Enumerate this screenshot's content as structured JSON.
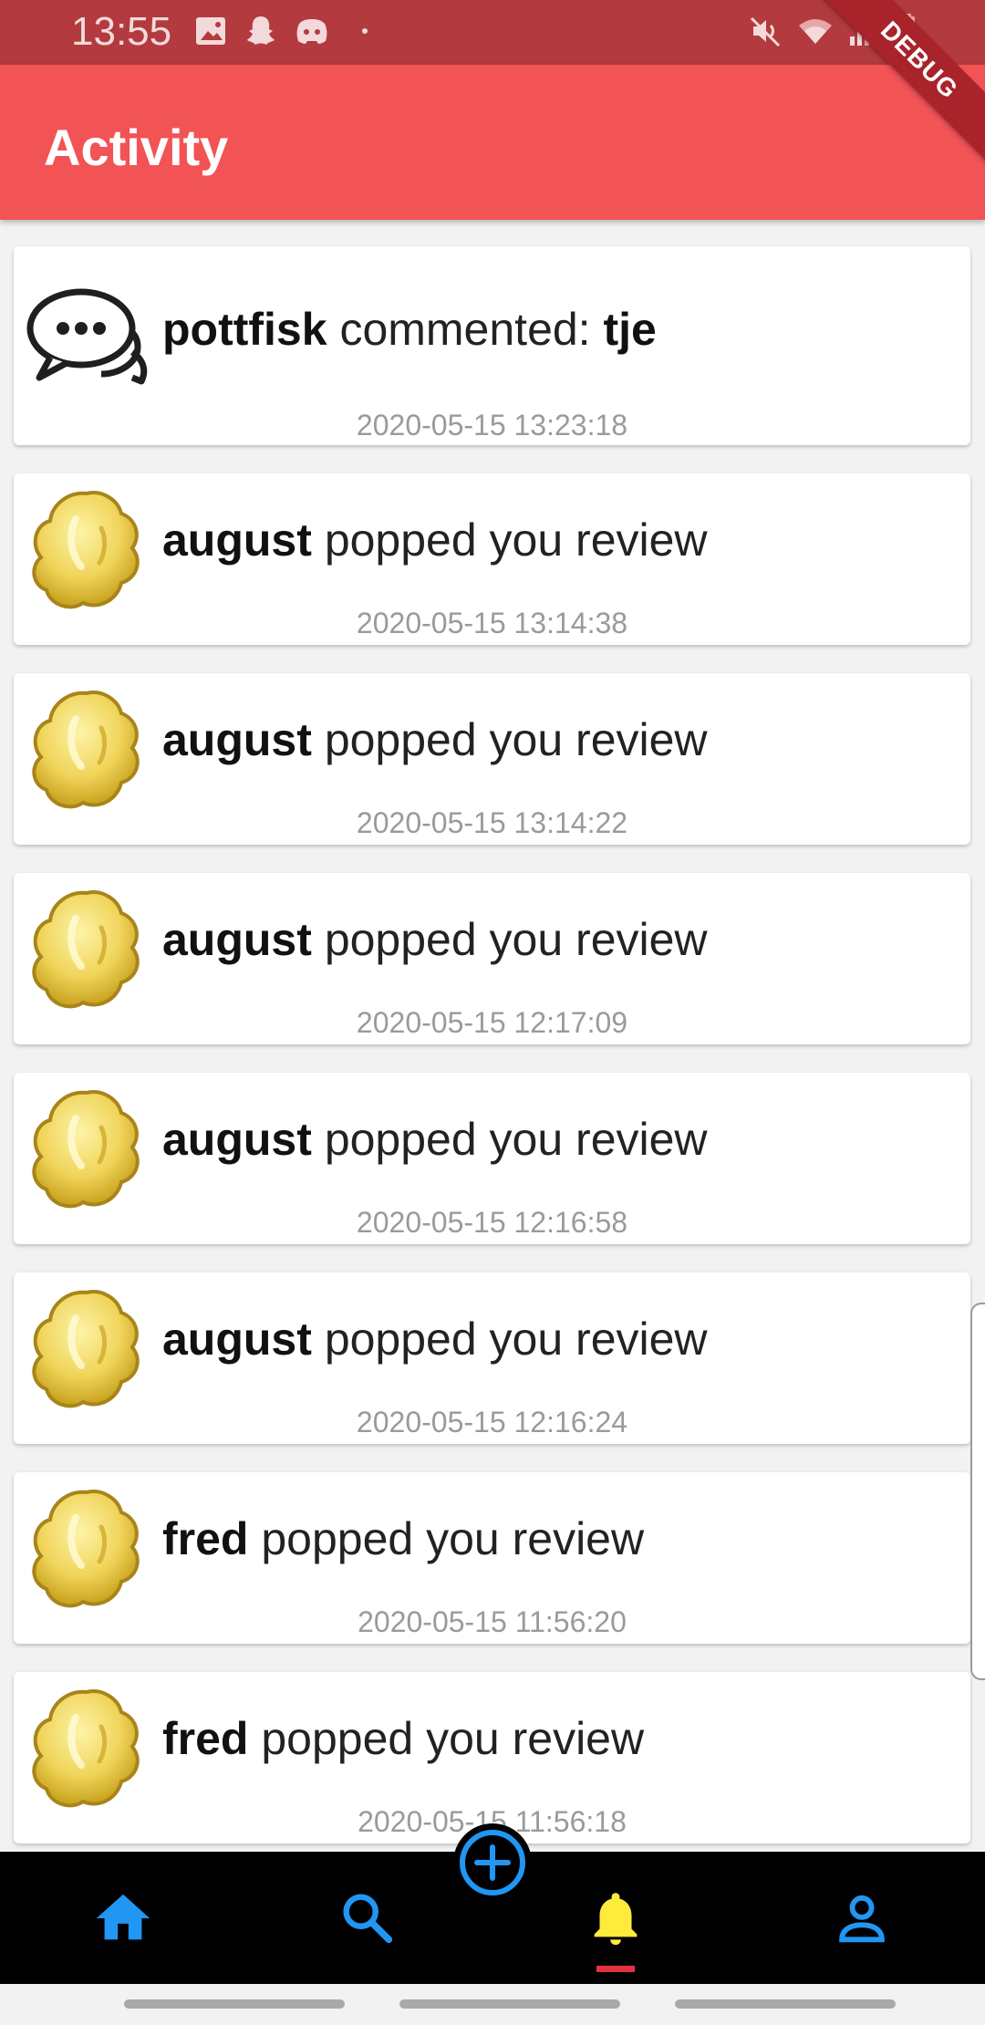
{
  "status_bar": {
    "time": "13:55"
  },
  "app_bar": {
    "title": "Activity",
    "debug_label": "DEBUG"
  },
  "feed": {
    "items": [
      {
        "type": "comment",
        "user": "pottfisk",
        "action": "commented:",
        "comment": "tje",
        "timestamp": "2020-05-15 13:23:18"
      },
      {
        "type": "pop",
        "user": "august",
        "action": "popped you review",
        "timestamp": "2020-05-15 13:14:38"
      },
      {
        "type": "pop",
        "user": "august",
        "action": "popped you review",
        "timestamp": "2020-05-15 13:14:22"
      },
      {
        "type": "pop",
        "user": "august",
        "action": "popped you review",
        "timestamp": "2020-05-15 12:17:09"
      },
      {
        "type": "pop",
        "user": "august",
        "action": "popped you review",
        "timestamp": "2020-05-15 12:16:58"
      },
      {
        "type": "pop",
        "user": "august",
        "action": "popped you review",
        "timestamp": "2020-05-15 12:16:24"
      },
      {
        "type": "pop",
        "user": "fred",
        "action": "popped you review",
        "timestamp": "2020-05-15 11:56:20"
      },
      {
        "type": "pop",
        "user": "fred",
        "action": "popped you review",
        "timestamp": "2020-05-15 11:56:18"
      }
    ]
  },
  "bottom_nav": {
    "items": [
      {
        "icon": "home-icon",
        "color": "#2196f3"
      },
      {
        "icon": "search-icon",
        "color": "#2196f3"
      },
      {
        "icon": "add-circle-icon",
        "color": "#2196f3"
      },
      {
        "icon": "bell-icon",
        "color": "#ffeb3b",
        "active": true
      },
      {
        "icon": "person-icon",
        "color": "#2196f3"
      }
    ]
  },
  "colors": {
    "app_bar": "#f25355",
    "status_bar": "#b33a3e",
    "accent": "#2196f3",
    "active": "#ffeb3b",
    "indicator": "#e3333f"
  }
}
